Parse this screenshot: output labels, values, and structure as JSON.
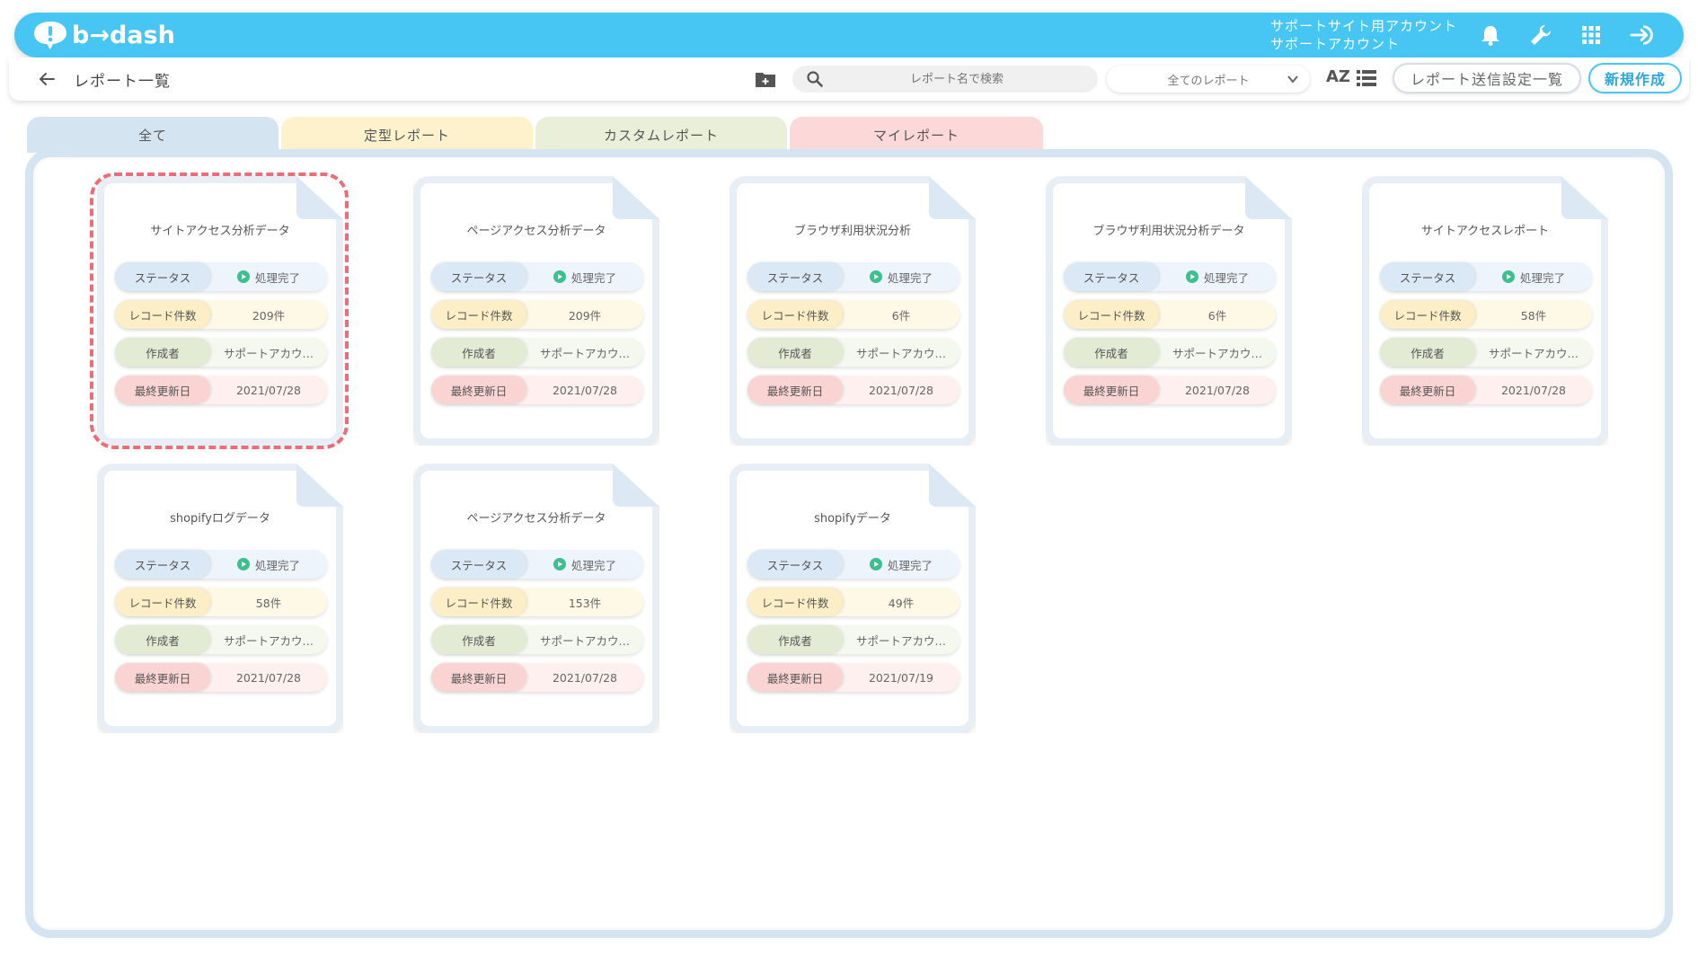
{
  "app": {
    "logo_text": "b→dash",
    "account_line1": "サポートサイト用アカウント",
    "account_line2": "サポートアカウント"
  },
  "toolbar": {
    "title": "レポート一覧",
    "search_placeholder": "レポート名で検索",
    "filter_value": "全てのレポート",
    "sort_label": "AZ",
    "send_settings_label": "レポート送信設定一覧",
    "new_label": "新規作成"
  },
  "tabs": [
    {
      "label": "全て"
    },
    {
      "label": "定型レポート"
    },
    {
      "label": "カスタムレポート"
    },
    {
      "label": "マイレポート"
    }
  ],
  "field_labels": {
    "status": "ステータス",
    "records": "レコード件数",
    "author": "作成者",
    "updated": "最終更新日"
  },
  "cards": [
    {
      "title": "サイトアクセス分析データ",
      "status": "処理完了",
      "records": "209件",
      "author": "サポートアカウ…",
      "updated": "2021/07/28"
    },
    {
      "title": "ページアクセス分析データ",
      "status": "処理完了",
      "records": "209件",
      "author": "サポートアカウ…",
      "updated": "2021/07/28"
    },
    {
      "title": "ブラウザ利用状況分析",
      "status": "処理完了",
      "records": "6件",
      "author": "サポートアカウ…",
      "updated": "2021/07/28"
    },
    {
      "title": "ブラウザ利用状況分析データ",
      "status": "処理完了",
      "records": "6件",
      "author": "サポートアカウ…",
      "updated": "2021/07/28"
    },
    {
      "title": "サイトアクセスレポート",
      "status": "処理完了",
      "records": "58件",
      "author": "サポートアカウ…",
      "updated": "2021/07/28"
    },
    {
      "title": "shopifyログデータ",
      "status": "処理完了",
      "records": "58件",
      "author": "サポートアカウ…",
      "updated": "2021/07/28"
    },
    {
      "title": "ページアクセス分析データ",
      "status": "処理完了",
      "records": "153件",
      "author": "サポートアカウ…",
      "updated": "2021/07/28"
    },
    {
      "title": "shopifyデータ",
      "status": "処理完了",
      "records": "49件",
      "author": "サポートアカウ…",
      "updated": "2021/07/19"
    }
  ],
  "colors": {
    "brand": "#47c6f4",
    "status_ok": "#3dbf8f",
    "highlight": "#ef6b75"
  },
  "icons": {
    "bell": "bell-icon",
    "wrench": "wrench-icon",
    "apps": "grid-icon",
    "logout": "logout-icon",
    "folder": "folder-add-icon",
    "search": "search-icon",
    "list": "list-icon"
  }
}
